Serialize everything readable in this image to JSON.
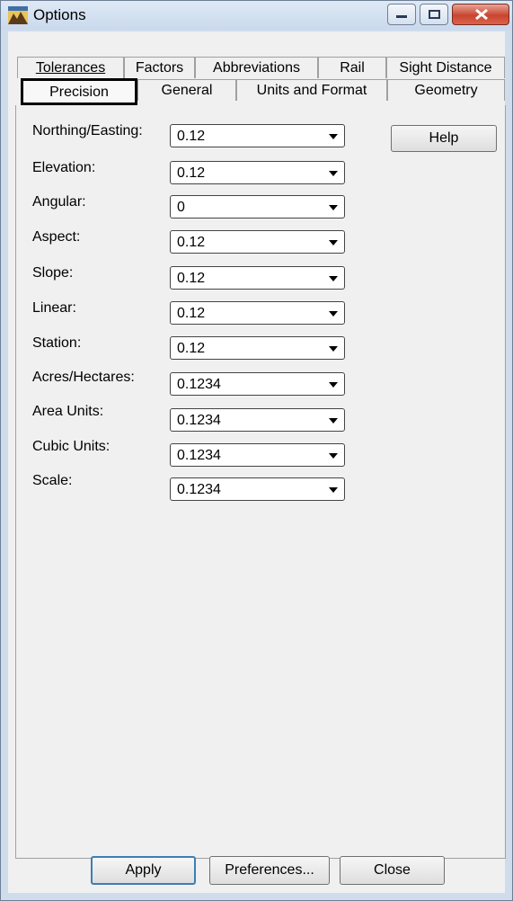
{
  "window": {
    "title": "Options"
  },
  "tabs_top": [
    {
      "label": "Tolerances"
    },
    {
      "label": "Factors"
    },
    {
      "label": "Abbreviations"
    },
    {
      "label": "Rail"
    },
    {
      "label": "Sight Distance"
    }
  ],
  "tabs_bottom": [
    {
      "label": "Precision"
    },
    {
      "label": "General"
    },
    {
      "label": "Units and Format"
    },
    {
      "label": "Geometry"
    }
  ],
  "fields": [
    {
      "label": "Northing/Easting:",
      "value": "0.12"
    },
    {
      "label": "Elevation:",
      "value": "0.12"
    },
    {
      "label": "Angular:",
      "value": "0"
    },
    {
      "label": "Aspect:",
      "value": "0.12"
    },
    {
      "label": "Slope:",
      "value": "0.12"
    },
    {
      "label": "Linear:",
      "value": "0.12"
    },
    {
      "label": "Station:",
      "value": "0.12"
    },
    {
      "label": "Acres/Hectares:",
      "value": "0.1234"
    },
    {
      "label": "Area Units:",
      "value": "0.1234"
    },
    {
      "label": "Cubic Units:",
      "value": "0.1234"
    },
    {
      "label": "Scale:",
      "value": "0.1234"
    }
  ],
  "buttons": {
    "help": "Help",
    "apply": "Apply",
    "preferences": "Preferences...",
    "close": "Close"
  }
}
